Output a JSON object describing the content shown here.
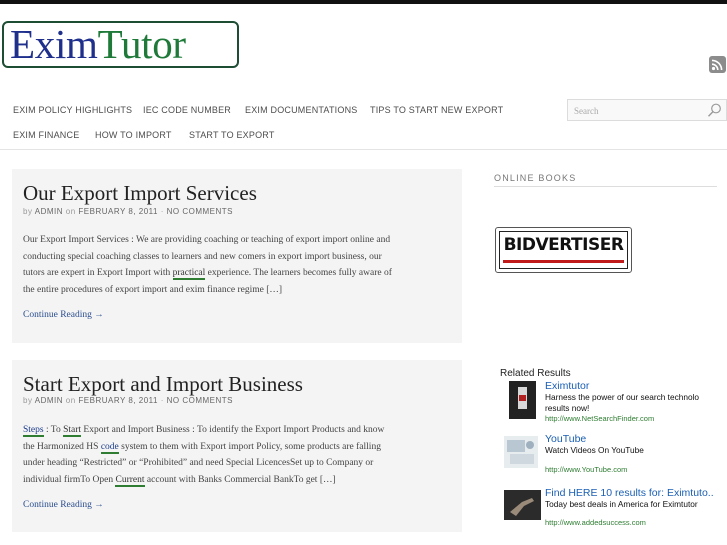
{
  "logo": {
    "part1": "Exim",
    "part2": "Tutor"
  },
  "nav": {
    "items": [
      "EXIM POLICY HIGHLIGHTS",
      "IEC CODE NUMBER",
      "EXIM DOCUMENTATIONS",
      "TIPS TO START NEW EXPORT",
      "EXIM FINANCE",
      "HOW TO IMPORT",
      "START TO EXPORT"
    ]
  },
  "search": {
    "placeholder": "Search"
  },
  "posts": [
    {
      "title": "Our Export Import Services",
      "meta_by": "by",
      "meta_author": "ADMIN",
      "meta_on": "on",
      "meta_date": "FEBRUARY 8, 2011",
      "meta_sep": "·",
      "meta_comments": "NO COMMENTS",
      "excerpt_line1": "Our Export Import Services : We are providing coaching or teaching of export import online and",
      "excerpt_line2": "conducting special coaching classes to learners and new comers in export import business, our",
      "excerpt_line3_a": "tutors are expert in Export Import with ",
      "excerpt_line3_link": "practical",
      "excerpt_line3_b": " experience. The learners becomes fully aware of",
      "excerpt_line4": "the entire procedures of export import and exim finance regime […]",
      "continue": "Continue Reading →"
    },
    {
      "title": "Start Export and Import Business",
      "meta_by": "by",
      "meta_author": "ADMIN",
      "meta_on": "on",
      "meta_date": "FEBRUARY 8, 2011",
      "meta_sep": "·",
      "meta_comments": "NO COMMENTS",
      "l1_link1": "Steps",
      "l1_a": " : To ",
      "l1_link2": "Start",
      "l1_b": " Export and Import Business : To identify the Export Import Products and know",
      "l2_a": "the Harmonized HS ",
      "l2_link": "code",
      "l2_b": " system to them with Export import Policy, some products are falling",
      "line3": "under heading “Restricted” or “Prohibited” and need Special LicencesSet up to Company or",
      "l4_a": "individual firmTo Open ",
      "l4_link": "Current",
      "l4_b": " account with Banks Commercial BankTo get […]",
      "continue": "Continue Reading →"
    }
  ],
  "sidebar": {
    "heading": "ONLINE BOOKS",
    "ad_label": "BIDVERTISER"
  },
  "related": {
    "heading": "Related Results",
    "items": [
      {
        "title": "Eximtutor",
        "desc1": "Harness the power of our search technolo",
        "desc2": "results now!",
        "url": "http://www.NetSearchFinder.com"
      },
      {
        "title": "YouTube",
        "desc1": "Watch Videos On YouTube",
        "url": "http://www.YouTube.com"
      },
      {
        "title": "Find HERE 10 results for: Eximtuto..",
        "desc1": "Today best deals in America for Eximtutor",
        "url": "http://www.addedsuccess.com"
      }
    ]
  },
  "colors": {
    "logo_blue": "#1f2f8c",
    "logo_green": "#1f7a3a",
    "link_blue": "#1a5fb4",
    "url_green": "#2e7d32"
  }
}
